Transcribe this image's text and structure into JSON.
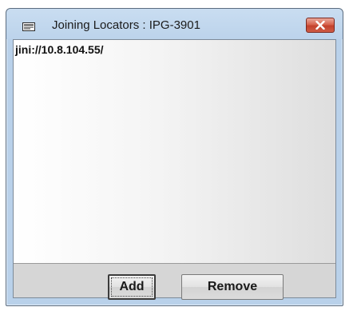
{
  "window": {
    "title": "Joining Locators : IPG-3901",
    "close_label": "Close"
  },
  "locators": {
    "items": [
      "jini://10.8.104.55/"
    ]
  },
  "buttons": {
    "add_label": "Add",
    "remove_label": "Remove"
  },
  "icons": {
    "app": "window-icon",
    "close": "close-icon"
  },
  "colors": {
    "titlebar": "#bcd3eb",
    "close_button": "#c3412c",
    "client_background": "#d6d6d6"
  }
}
